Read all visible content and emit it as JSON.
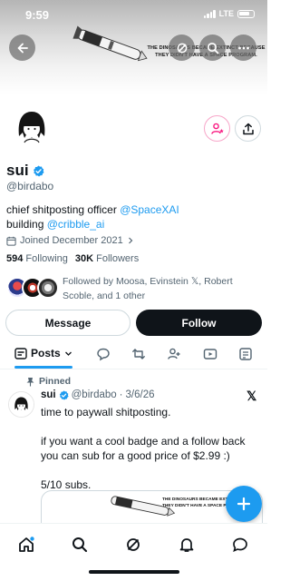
{
  "status_bar": {
    "time": "9:59",
    "network": "LTE"
  },
  "banner": {
    "caption": "THE DINOSAURS BECAME EXTINCT BECAUSE THEY DIDN'T HAVE A SPACE PROGRAM."
  },
  "profile": {
    "name": "sui",
    "handle": "@birdabo",
    "bio_line1_prefix": "chief shitposting officer ",
    "bio_line1_link": "@SpaceXAI",
    "bio_line2_prefix": "building ",
    "bio_line2_link": "@cribble_ai",
    "joined": "Joined December 2021",
    "following_count": "594",
    "following_label": "Following",
    "followers_count": "30K",
    "followers_label": "Followers",
    "followed_by": "Followed by Moosa, Evinstein 𝕏, Robert Scoble, and 1 other"
  },
  "actions": {
    "message_label": "Message",
    "follow_label": "Follow"
  },
  "tabs": {
    "posts_label": "Posts"
  },
  "pinned_post": {
    "pinned_label": "Pinned",
    "author_name": "sui",
    "author_handle": "@birdabo",
    "date": "3/6/26",
    "body": "time to paywall shitposting.\n\nif you want a cool badge and a follow back you can sub for a good price of $2.99 :)\n\n5/10 subs."
  },
  "colors": {
    "accent": "#1d9bf0",
    "text": "#0f1419",
    "muted": "#536471",
    "verified": "#1d9bf0",
    "pink": "#f91880"
  }
}
